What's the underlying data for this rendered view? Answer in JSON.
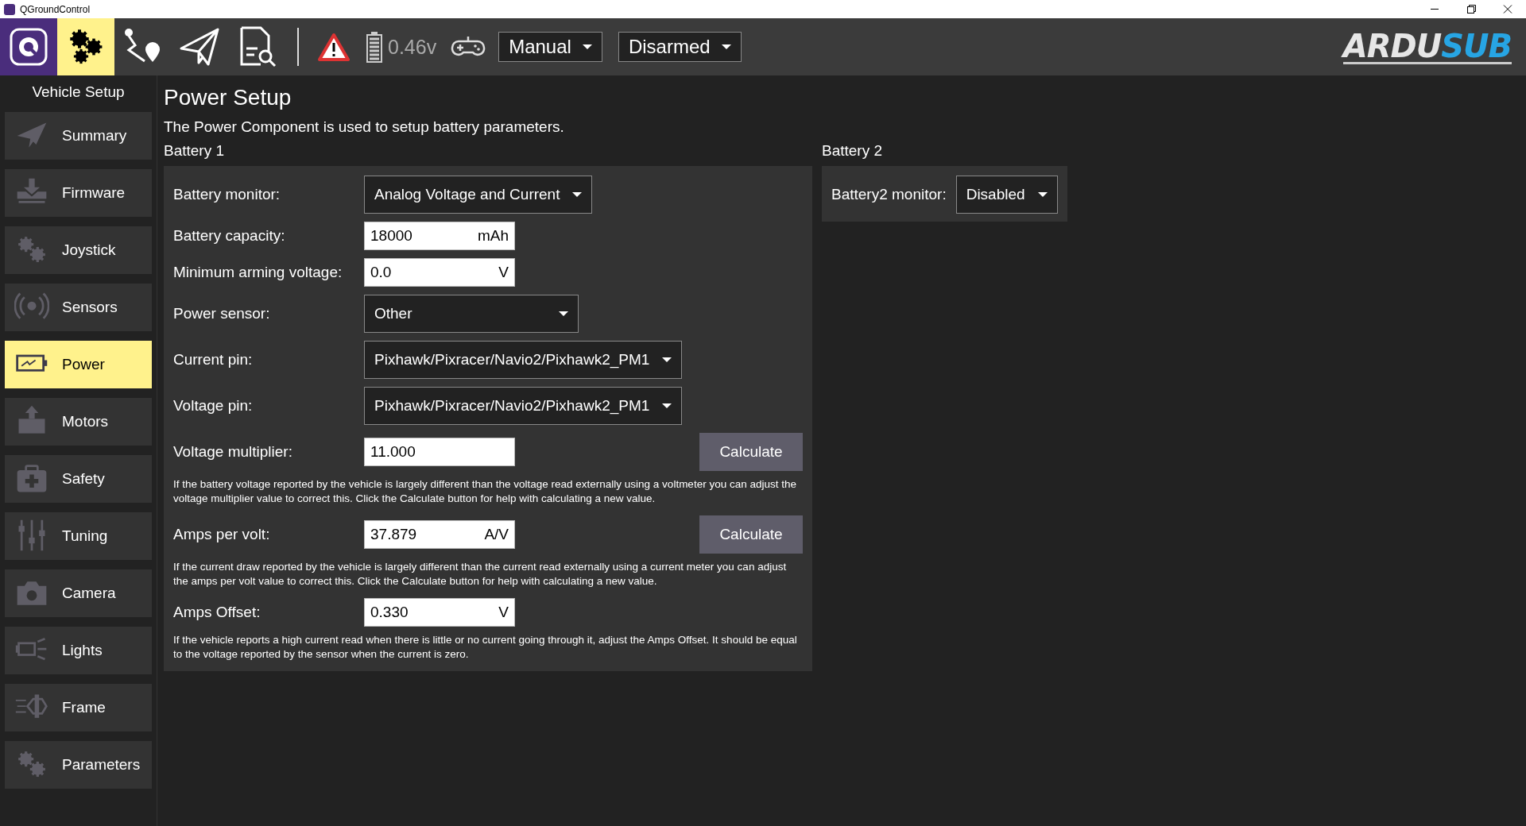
{
  "window": {
    "title": "QGroundControl"
  },
  "toolbar": {
    "tools": [
      {
        "selected": false
      },
      {
        "selected": true
      },
      {
        "selected": false
      },
      {
        "selected": false
      },
      {
        "selected": false
      }
    ],
    "battery_reading": "0.46v",
    "flight_mode": "Manual",
    "arm_state": "Disarmed",
    "logo_parts": [
      "ARDU",
      "SUB"
    ]
  },
  "sidebar": {
    "title": "Vehicle Setup",
    "items": [
      {
        "label": "Summary",
        "selected": false
      },
      {
        "label": "Firmware",
        "selected": false
      },
      {
        "label": "Joystick",
        "selected": false
      },
      {
        "label": "Sensors",
        "selected": false
      },
      {
        "label": "Power",
        "selected": true
      },
      {
        "label": "Motors",
        "selected": false
      },
      {
        "label": "Safety",
        "selected": false
      },
      {
        "label": "Tuning",
        "selected": false
      },
      {
        "label": "Camera",
        "selected": false
      },
      {
        "label": "Lights",
        "selected": false
      },
      {
        "label": "Frame",
        "selected": false
      },
      {
        "label": "Parameters",
        "selected": false
      }
    ]
  },
  "page": {
    "title": "Power Setup",
    "description": "The Power Component is used to setup battery parameters.",
    "battery_1": {
      "title": "Battery 1",
      "rows": [
        {
          "kind": "dropdown",
          "label": "Battery monitor:",
          "value": "Analog Voltage and Current"
        },
        {
          "kind": "input",
          "label": "Battery capacity:",
          "value": "18000",
          "unit": "mAh"
        },
        {
          "kind": "input",
          "label": "Minimum arming voltage:",
          "value": "0.0",
          "unit": "V"
        },
        {
          "kind": "dropdown",
          "label": "Power sensor:",
          "value": "Other"
        },
        {
          "kind": "dropdown",
          "label": "Current pin:",
          "value": "Pixhawk/Pixracer/Navio2/Pixhawk2_PM1"
        },
        {
          "kind": "dropdown",
          "label": "Voltage pin:",
          "value": "Pixhawk/Pixracer/Navio2/Pixhawk2_PM1"
        },
        {
          "kind": "input",
          "label": "Voltage multiplier:",
          "value": "11.000",
          "button": "Calculate"
        },
        {
          "kind": "note",
          "text": "If the battery voltage reported by the vehicle is largely different than the voltage read externally using a voltmeter you can adjust the voltage multiplier value to correct this. Click the Calculate button for help with calculating a new value."
        },
        {
          "kind": "input",
          "label": "Amps per volt:",
          "value": "37.879",
          "unit": "A/V",
          "button": "Calculate"
        },
        {
          "kind": "note",
          "text": "If the current draw reported by the vehicle is largely different than the current read externally using a current meter you can adjust the amps per volt value to correct this. Click the Calculate button for help with calculating a new value."
        },
        {
          "kind": "input",
          "label": "Amps Offset:",
          "value": "0.330",
          "unit": "V"
        },
        {
          "kind": "note",
          "text": "If the vehicle reports a high current read when there is little or no current going through it, adjust the Amps Offset. It should be equal to the voltage reported by the sensor when the current is zero."
        }
      ]
    },
    "battery_2": {
      "title": "Battery 2",
      "rows": [
        {
          "kind": "dropdown",
          "label": "Battery2 monitor:",
          "value": "Disabled"
        }
      ]
    }
  }
}
